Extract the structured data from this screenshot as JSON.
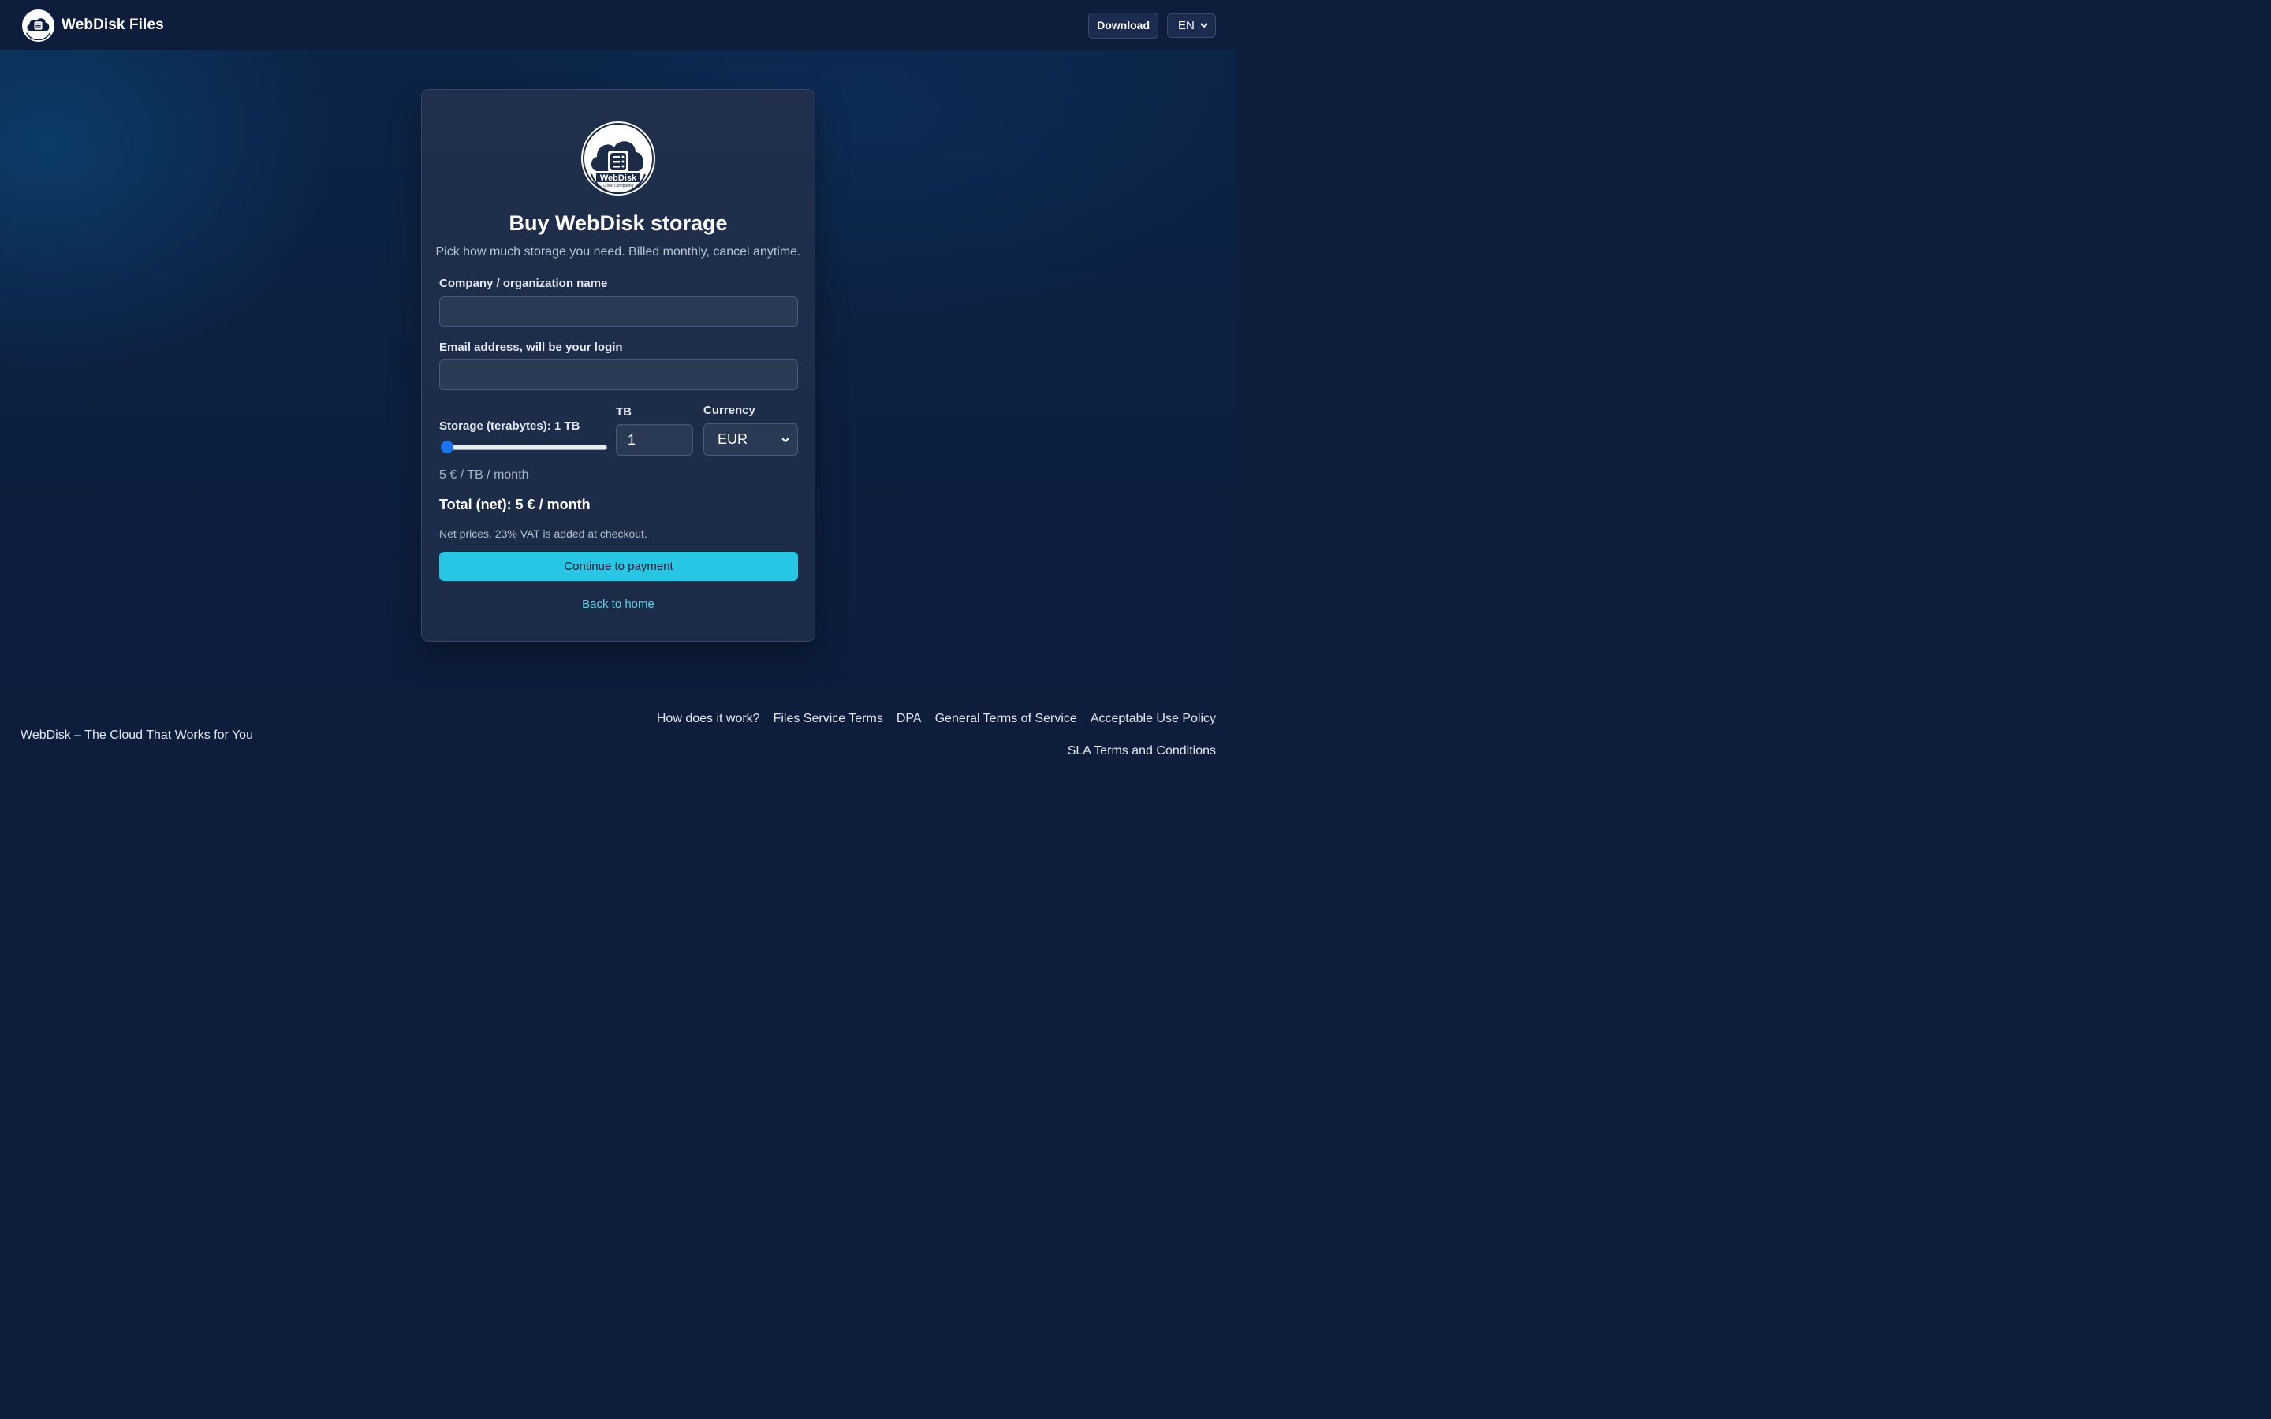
{
  "header": {
    "brand_name": "WebDisk Files",
    "download_label": "Download",
    "language": "EN"
  },
  "card": {
    "logo_text": "WebDisk",
    "logo_subtext": "Cloud Computing",
    "title": "Buy WebDisk storage",
    "subtitle": "Pick how much storage you need. Billed monthly, cancel anytime.",
    "company_label": "Company / organization name",
    "company_value": "",
    "email_label": "Email address, will be your login",
    "email_value": "",
    "storage_label": "Storage (terabytes): 1 TB",
    "storage_slider_value": 1,
    "tb_label": "TB",
    "tb_value": "1",
    "currency_label": "Currency",
    "currency_value": "EUR",
    "price_per": "5 € / TB / month",
    "total": "Total (net): 5 € / month",
    "vat_note": "Net prices. 23% VAT is added at checkout.",
    "pay_button": "Continue to payment",
    "back_link": "Back to home"
  },
  "footer": {
    "tagline": "WebDisk – The Cloud That Works for You",
    "links": [
      "How does it work?",
      "Files Service Terms",
      "DPA",
      "General Terms of Service",
      "Acceptable Use Policy"
    ],
    "sla_link": "SLA Terms and Conditions"
  },
  "colors": {
    "accent": "#27c6e4",
    "link": "#5ed3ec",
    "slider": "#1a73f0",
    "background": "#0f1e3d"
  },
  "icons": [
    "cloud-server-logo-icon",
    "chevron-down-icon"
  ]
}
